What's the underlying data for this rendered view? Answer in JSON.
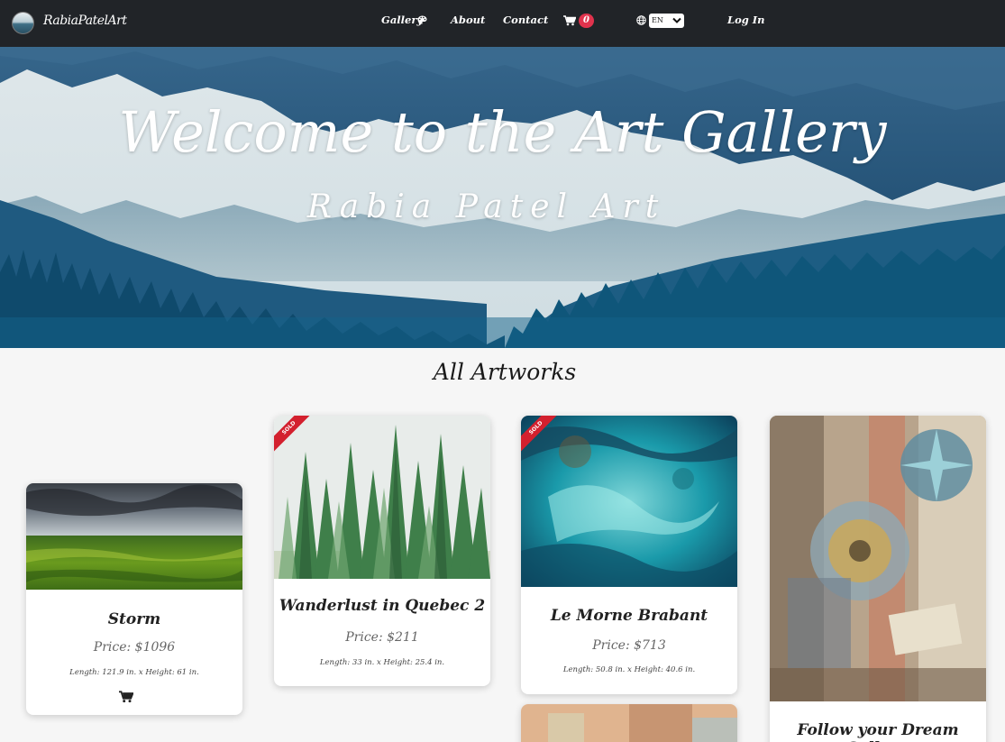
{
  "nav": {
    "brand": "RabiaPatelArt",
    "gallery": "Gallery",
    "about": "About",
    "contact": "Contact",
    "cart_count": "0",
    "language": "EN",
    "login": "Log In"
  },
  "hero": {
    "title": "Welcome to the Art Gallery",
    "subtitle": "Rabia Patel Art"
  },
  "section_title": "All Artworks",
  "artworks": [
    {
      "title": "Storm",
      "price": "Price: $1096",
      "dims": "Length: 121.9 in. x Height: 61 in.",
      "sold": false
    },
    {
      "title": "Wanderlust in Quebec 2",
      "price": "Price: $211",
      "dims": "Length: 33 in. x Height: 25.4 in.",
      "sold": true,
      "sold_label": "SOLD"
    },
    {
      "title": "Le Morne Brabant",
      "price": "Price: $713",
      "dims": "Length: 50.8 in. x Height: 40.6 in.",
      "sold": true,
      "sold_label": "SOLD"
    },
    {
      "title": "Follow your Dream Collage",
      "price": "",
      "dims": "",
      "sold": false
    }
  ],
  "colors": {
    "navbar": "#212428",
    "badge": "#e0334d",
    "sold_ribbon": "#d3202e",
    "page_bg": "#f6f6f6"
  },
  "icons": [
    "palette-icon",
    "cart-icon",
    "globe-icon",
    "chevron-down-icon",
    "add-to-cart-icon"
  ]
}
